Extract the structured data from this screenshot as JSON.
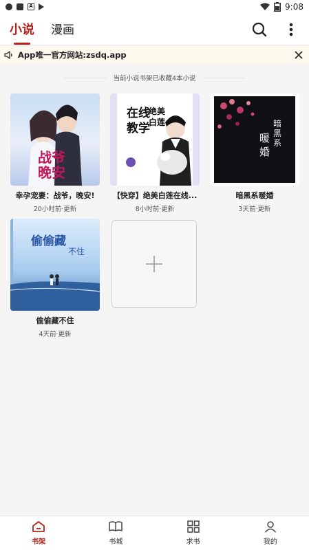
{
  "status_bar": {
    "time": "9:08"
  },
  "header": {
    "tabs": [
      {
        "label": "小说",
        "active": true
      },
      {
        "label": "漫画",
        "active": false
      }
    ]
  },
  "notice": {
    "text": "App唯一官方网站:zsdq.app"
  },
  "shelf": {
    "summary": "当前小说书架已收藏4本小说",
    "books": [
      {
        "title": "幸孕宠妻：战爷，晚安!",
        "update": "20小时前·更新",
        "cover_text": "战爷晚安"
      },
      {
        "title": "【快穿】绝美白莲在线...",
        "update": "8小时前·更新",
        "cover_text": "在线教学 绝美白莲"
      },
      {
        "title": "暗黑系暖婚",
        "update": "3天前·更新",
        "cover_text": "暗黑系暖婚"
      },
      {
        "title": "偷偷藏不住",
        "update": "4天前·更新",
        "cover_text": "偷偷藏不住"
      }
    ]
  },
  "bottom_nav": [
    {
      "label": "书架",
      "icon": "home-icon",
      "active": true
    },
    {
      "label": "书城",
      "icon": "book-icon",
      "active": false
    },
    {
      "label": "求书",
      "icon": "grid-icon",
      "active": false
    },
    {
      "label": "我的",
      "icon": "user-icon",
      "active": false
    }
  ],
  "colors": {
    "accent": "#b3231a",
    "notice_bg": "#fff8ee"
  }
}
